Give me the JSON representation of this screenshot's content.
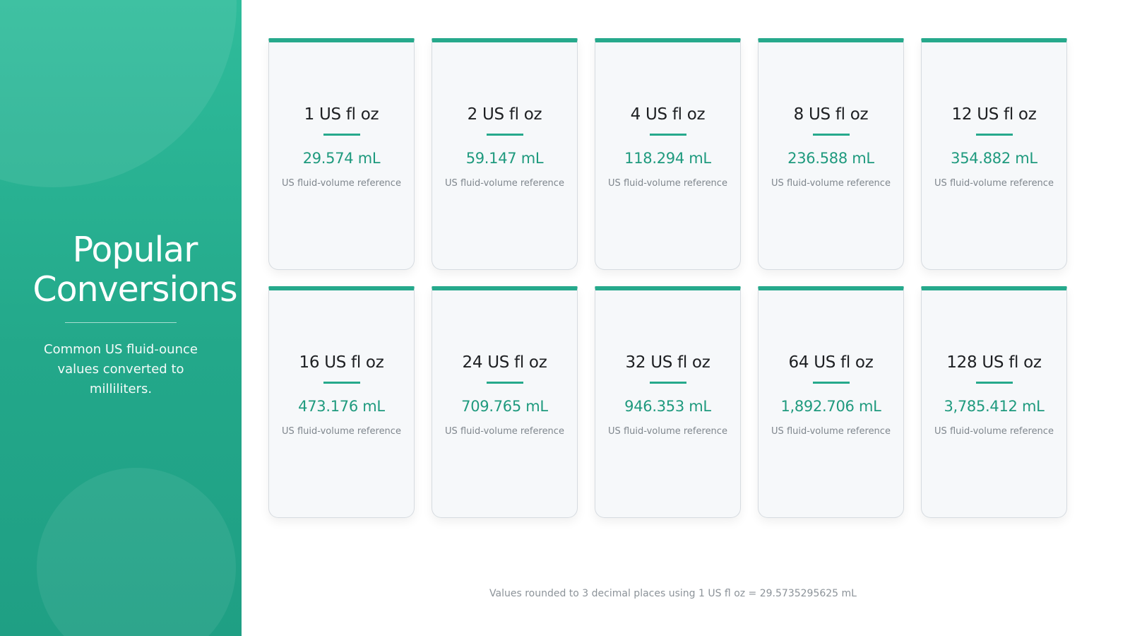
{
  "sidebar": {
    "title_line1": "Popular",
    "title_line2": "Conversions",
    "subtitle": "Common US fluid-ounce values converted to milliliters."
  },
  "cards": [
    {
      "oz": "1 US fl oz",
      "ml": "29.574 mL",
      "ref": "US fluid-volume reference"
    },
    {
      "oz": "2 US fl oz",
      "ml": "59.147 mL",
      "ref": "US fluid-volume reference"
    },
    {
      "oz": "4 US fl oz",
      "ml": "118.294 mL",
      "ref": "US fluid-volume reference"
    },
    {
      "oz": "8 US fl oz",
      "ml": "236.588 mL",
      "ref": "US fluid-volume reference"
    },
    {
      "oz": "12 US fl oz",
      "ml": "354.882 mL",
      "ref": "US fluid-volume reference"
    },
    {
      "oz": "16 US fl oz",
      "ml": "473.176 mL",
      "ref": "US fluid-volume reference"
    },
    {
      "oz": "24 US fl oz",
      "ml": "709.765 mL",
      "ref": "US fluid-volume reference"
    },
    {
      "oz": "32 US fl oz",
      "ml": "946.353 mL",
      "ref": "US fluid-volume reference"
    },
    {
      "oz": "64 US fl oz",
      "ml": "1,892.706 mL",
      "ref": "US fluid-volume reference"
    },
    {
      "oz": "128 US fl oz",
      "ml": "3,785.412 mL",
      "ref": "US fluid-volume reference"
    }
  ],
  "footnote": "Values rounded to 3 decimal places using 1 US fl oz = 29.5735295625 mL",
  "colors": {
    "accent": "#26a98c",
    "sidebar_top": "#2fbc9b",
    "sidebar_bottom": "#1f9f84",
    "value_text": "#1f9a7e"
  }
}
